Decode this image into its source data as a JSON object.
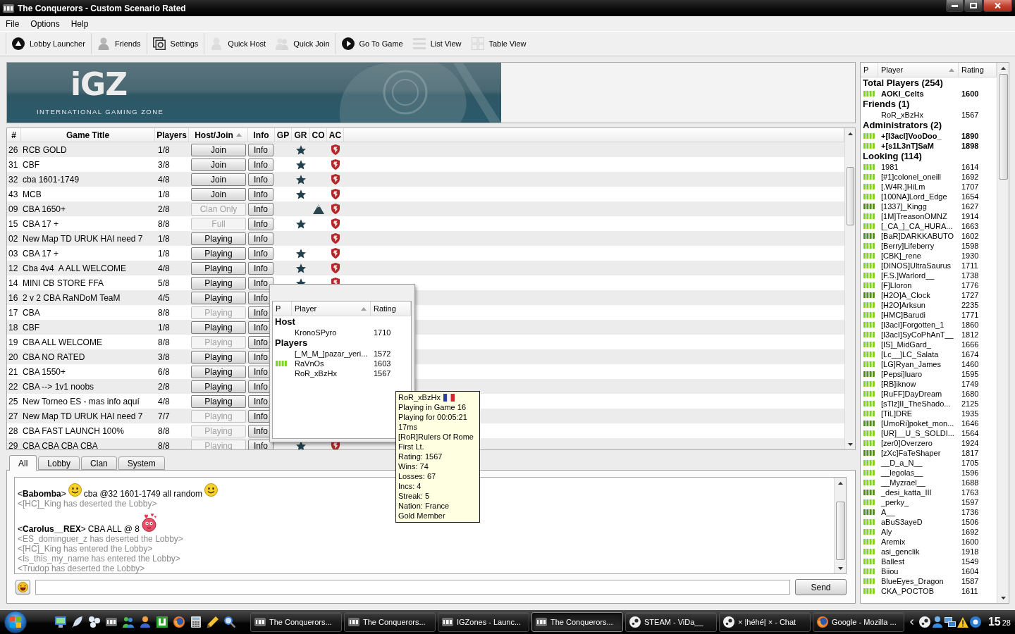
{
  "window": {
    "title": "The Conquerors - Custom Scenario Rated"
  },
  "menu": [
    {
      "label": "File"
    },
    {
      "label": "Options"
    },
    {
      "label": "Help"
    }
  ],
  "toolbar": [
    [
      {
        "label": "Lobby Launcher",
        "kind": "launcher",
        "disabled": false
      }
    ],
    [
      {
        "label": "Friends",
        "kind": "friends",
        "disabled": false
      }
    ],
    [
      {
        "label": "Settings",
        "kind": "settings",
        "disabled": false
      }
    ],
    [
      {
        "label": "Quick Host",
        "kind": "host",
        "disabled": true
      },
      {
        "label": "Quick Join",
        "kind": "join",
        "disabled": true
      }
    ],
    [
      {
        "label": "Go To Game",
        "kind": "play",
        "disabled": false
      },
      {
        "label": "List View",
        "kind": "list",
        "disabled": true
      },
      {
        "label": "Table View",
        "kind": "table",
        "disabled": true
      }
    ]
  ],
  "banner": {
    "logo": "iGZ",
    "tagline": "INTERNATIONAL GAMING ZONE"
  },
  "games": {
    "columns": [
      {
        "label": "#",
        "sorted": false
      },
      {
        "label": "Game Title",
        "sorted": false
      },
      {
        "label": "Players",
        "sorted": false
      },
      {
        "label": "Host/Join",
        "sorted": true
      },
      {
        "label": "Info",
        "sorted": false
      },
      {
        "label": "GP",
        "sorted": false
      },
      {
        "label": "GR",
        "sorted": false
      },
      {
        "label": "CO",
        "sorted": false
      },
      {
        "label": "AC",
        "sorted": false
      }
    ],
    "rows": [
      {
        "number": "26",
        "title": "RCB GOLD",
        "players": "1/8",
        "action": "Join",
        "disabled": false,
        "info": "Info",
        "gr": true,
        "co": false,
        "ac": true
      },
      {
        "number": "31",
        "title": "CBF",
        "players": "3/8",
        "action": "Join",
        "disabled": false,
        "info": "Info",
        "gr": true,
        "co": false,
        "ac": true
      },
      {
        "number": "32",
        "title": "cba 1601-1749",
        "players": "4/8",
        "action": "Join",
        "disabled": false,
        "info": "Info",
        "gr": true,
        "co": false,
        "ac": true
      },
      {
        "number": "43",
        "title": "MCB",
        "players": "1/8",
        "action": "Join",
        "disabled": false,
        "info": "Info",
        "gr": true,
        "co": false,
        "ac": true
      },
      {
        "number": "09",
        "title": "CBA 1650+",
        "players": "2/8",
        "action": "Clan Only",
        "disabled": true,
        "info": "Info",
        "gr": false,
        "co": true,
        "ac": true
      },
      {
        "number": "15",
        "title": "CBA 17 +",
        "players": "8/8",
        "action": "Full",
        "disabled": true,
        "info": "Info",
        "gr": true,
        "co": false,
        "ac": true
      },
      {
        "number": "02",
        "title": "New Map TD URUK HAI need 7",
        "players": "1/8",
        "action": "Playing",
        "disabled": false,
        "info": "Info",
        "gr": false,
        "co": false,
        "ac": true
      },
      {
        "number": "03",
        "title": "CBA 17 +",
        "players": "1/8",
        "action": "Playing",
        "disabled": false,
        "info": "Info",
        "gr": true,
        "co": false,
        "ac": true
      },
      {
        "number": "12",
        "title": "Cba 4v4  A ALL WELCOME",
        "players": "4/8",
        "action": "Playing",
        "disabled": false,
        "info": "Info",
        "gr": true,
        "co": false,
        "ac": true
      },
      {
        "number": "14",
        "title": "MINI CB STORE FFA",
        "players": "5/8",
        "action": "Playing",
        "disabled": false,
        "info": "Info",
        "gr": true,
        "co": false,
        "ac": true
      },
      {
        "number": "16",
        "title": "2 v 2 CBA RaNDoM TeaM",
        "players": "4/5",
        "action": "Playing",
        "disabled": false,
        "info": "Info"
      },
      {
        "number": "17",
        "title": "CBA",
        "players": "8/8",
        "action": "Playing",
        "disabled": true,
        "info": "Info"
      },
      {
        "number": "18",
        "title": "CBF",
        "players": "1/8",
        "action": "Playing",
        "disabled": false,
        "info": "Info"
      },
      {
        "number": "19",
        "title": "CBA ALL WELCOME",
        "players": "8/8",
        "action": "Playing",
        "disabled": true,
        "info": "Info"
      },
      {
        "number": "20",
        "title": "CBA NO RATED",
        "players": "3/8",
        "action": "Playing",
        "disabled": false,
        "info": "Info"
      },
      {
        "number": "21",
        "title": "CBA 1550+",
        "players": "6/8",
        "action": "Playing",
        "disabled": false,
        "info": "Info"
      },
      {
        "number": "22",
        "title": "CBA --> 1v1 noobs",
        "players": "2/8",
        "action": "Playing",
        "disabled": false,
        "info": "Info"
      },
      {
        "number": "25",
        "title": "New Torneo ES - mas info aquí",
        "players": "4/8",
        "action": "Playing",
        "disabled": false,
        "info": "Info"
      },
      {
        "number": "27",
        "title": "New Map TD URUK HAI need 7",
        "players": "7/7",
        "action": "Playing",
        "disabled": true,
        "info": "Info"
      },
      {
        "number": "28",
        "title": "CBA FAST LAUNCH 100%",
        "players": "8/8",
        "action": "Playing",
        "disabled": true,
        "info": "Info"
      },
      {
        "number": "29",
        "title": "CBA CBA CBA CBA",
        "players": "8/8",
        "action": "Playing",
        "disabled": true,
        "info": "Info",
        "gr": true,
        "co": false,
        "ac": true
      }
    ]
  },
  "players_panel": {
    "columns": [
      {
        "label": "P",
        "sorted": false
      },
      {
        "label": "Player",
        "sorted": true
      },
      {
        "label": "Rating",
        "sorted": false
      }
    ],
    "groups": [
      {
        "title": "Total Players (254)",
        "players": [
          {
            "name": "AOKI_Celts",
            "rating": "1600",
            "emphasized": true,
            "color": "#7cd420"
          }
        ]
      },
      {
        "title": "Friends (1)",
        "players": [
          {
            "name": "RoR_xBzHx",
            "rating": "1567",
            "emphasized": false
          }
        ]
      },
      {
        "title": "Administrators (2)",
        "players": [
          {
            "name": "+[I3acI]VooDoo_",
            "rating": "1890",
            "emphasized": true,
            "color": "#7cd420"
          },
          {
            "name": "+[s1L3nT]SaM",
            "rating": "1898",
            "emphasized": true,
            "color": "#7cd420"
          }
        ]
      },
      {
        "title": "Looking (114)",
        "players": [
          {
            "name": "1981",
            "rating": "1614",
            "emphasized": false,
            "color": "#7cd420"
          },
          {
            "name": "[#1]colonel_oneill",
            "rating": "1692",
            "emphasized": false,
            "color": "#7cd420"
          },
          {
            "name": "[.W4R.]HiLm",
            "rating": "1707",
            "emphasized": false,
            "color": "#7cd420"
          },
          {
            "name": "[100NA]Lord_Edge",
            "rating": "1654",
            "emphasized": false,
            "color": "#7cd420"
          },
          {
            "name": "[1337]_Kingg",
            "rating": "1627",
            "emphasized": false,
            "color": "#4f8f1c"
          },
          {
            "name": "[1M]TreasonOMNZ",
            "rating": "1914",
            "emphasized": false,
            "color": "#7cd420"
          },
          {
            "name": "[_CA_]_CA_HURA...",
            "rating": "1663",
            "emphasized": false,
            "color": "#7cd420"
          },
          {
            "name": "[BaR]DARKKABUTO",
            "rating": "1602",
            "emphasized": false,
            "color": "#4f8f1c"
          },
          {
            "name": "[Berry]Lifeberry",
            "rating": "1598",
            "emphasized": false,
            "color": "#7cd420"
          },
          {
            "name": "[CBK]_rene",
            "rating": "1930",
            "emphasized": false,
            "color": "#7cd420"
          },
          {
            "name": "[DINOS]UltraSaurus",
            "rating": "1711",
            "emphasized": false,
            "color": "#7cd420"
          },
          {
            "name": "[F.S.]Warlord__",
            "rating": "1738",
            "emphasized": false,
            "color": "#7cd420"
          },
          {
            "name": "[F]Lloron",
            "rating": "1776",
            "emphasized": false,
            "color": "#7cd420"
          },
          {
            "name": "[H2O]A_Clock",
            "rating": "1727",
            "emphasized": false,
            "color": "#4f8f1c"
          },
          {
            "name": "[H2O]Arksun",
            "rating": "2235",
            "emphasized": false,
            "color": "#7cd420"
          },
          {
            "name": "[HMC]Barudi",
            "rating": "1771",
            "emphasized": false,
            "color": "#7cd420"
          },
          {
            "name": "[I3acI]Forgotten_1",
            "rating": "1860",
            "emphasized": false,
            "color": "#7cd420"
          },
          {
            "name": "[I3acI]SyCoPhAnT__",
            "rating": "1812",
            "emphasized": false,
            "color": "#7cd420"
          },
          {
            "name": "[IS]_MidGard_",
            "rating": "1666",
            "emphasized": false,
            "color": "#7cd420"
          },
          {
            "name": "[Lc__]LC_Salata",
            "rating": "1674",
            "emphasized": false,
            "color": "#7cd420"
          },
          {
            "name": "[LG]Ryan_James",
            "rating": "1460",
            "emphasized": false,
            "color": "#7cd420"
          },
          {
            "name": "[Pepsi]luaro",
            "rating": "1595",
            "emphasized": false,
            "color": "#4f8f1c"
          },
          {
            "name": "[RB]iknow",
            "rating": "1749",
            "emphasized": false,
            "color": "#7cd420"
          },
          {
            "name": "[RuFF]DayDream",
            "rating": "1680",
            "emphasized": false,
            "color": "#7cd420"
          },
          {
            "name": "[sTlz]II_TheShado...",
            "rating": "2125",
            "emphasized": false,
            "color": "#7cd420"
          },
          {
            "name": "[TiL]DRE",
            "rating": "1935",
            "emphasized": false,
            "color": "#7cd420"
          },
          {
            "name": "[UmoRi]poket_mon...",
            "rating": "1646",
            "emphasized": false,
            "color": "#4f8f1c"
          },
          {
            "name": "[UR]__U_S_SOLDI...",
            "rating": "1564",
            "emphasized": false,
            "color": "#7cd420"
          },
          {
            "name": "[zer0]Overzero",
            "rating": "1924",
            "emphasized": false,
            "color": "#7cd420"
          },
          {
            "name": "[zXc]FaTeShaper",
            "rating": "1817",
            "emphasized": false,
            "color": "#4f8f1c"
          },
          {
            "name": "__D_a_N__",
            "rating": "1705",
            "emphasized": false,
            "color": "#7cd420"
          },
          {
            "name": "__legolas__",
            "rating": "1596",
            "emphasized": false,
            "color": "#7cd420"
          },
          {
            "name": "__Myzrael__",
            "rating": "1688",
            "emphasized": false,
            "color": "#7cd420"
          },
          {
            "name": "_desi_katta_III",
            "rating": "1763",
            "emphasized": false,
            "color": "#4f8f1c"
          },
          {
            "name": "_perky_",
            "rating": "1597",
            "emphasized": false,
            "color": "#7cd420"
          },
          {
            "name": "A__",
            "rating": "1736",
            "emphasized": false,
            "color": "#4f8f1c"
          },
          {
            "name": "aBuS3ayeD",
            "rating": "1506",
            "emphasized": false,
            "color": "#7cd420"
          },
          {
            "name": "Aly",
            "rating": "1692",
            "emphasized": false,
            "color": "#7cd420"
          },
          {
            "name": "Aremix",
            "rating": "1600",
            "emphasized": false,
            "color": "#7cd420"
          },
          {
            "name": "asi_genclik",
            "rating": "1918",
            "emphasized": false,
            "color": "#7cd420"
          },
          {
            "name": "Ballest",
            "rating": "1549",
            "emphasized": false,
            "color": "#7cd420"
          },
          {
            "name": "Biiou",
            "rating": "1604",
            "emphasized": false,
            "color": "#7cd420"
          },
          {
            "name": "BlueEyes_Dragon",
            "rating": "1587",
            "emphasized": false,
            "color": "#7cd420"
          },
          {
            "name": "CKA_POCTOB",
            "rating": "1611",
            "emphasized": false,
            "color": "#7cd420"
          }
        ]
      }
    ]
  },
  "chat": {
    "tabs": [
      {
        "label": "All",
        "selected": true
      },
      {
        "label": "Lobby",
        "selected": false
      },
      {
        "label": "Clan",
        "selected": false
      },
      {
        "label": "System",
        "selected": false
      }
    ],
    "messages": [
      {
        "kind": "user",
        "sender": "<**Babomba**>",
        "segments": [
          {
            "kind": "smiley"
          },
          {
            "kind": "text",
            "text": "cba @32 1601-1749 all random"
          },
          {
            "kind": "smiley"
          }
        ]
      },
      {
        "kind": "system",
        "text": "<[HC]_King has deserted the Lobby>"
      },
      {
        "kind": "user",
        "sender": "<**Carolus__REX**>",
        "segments": [
          {
            "kind": "text",
            "text": "CBA ALL @ 8"
          },
          {
            "kind": "love"
          }
        ]
      },
      {
        "kind": "system",
        "text": "<ES_dominguer_z has deserted the Lobby>"
      },
      {
        "kind": "system",
        "text": "<[HC]_King has entered the Lobby>"
      },
      {
        "kind": "system",
        "text": "<Is_this_my_name has entered the Lobby>"
      },
      {
        "kind": "system",
        "text": "<Trudop has deserted the Lobby>"
      }
    ],
    "send": "Send"
  },
  "game_popup": {
    "columns": [
      {
        "label": "P",
        "sorted": false
      },
      {
        "label": "Player",
        "sorted": true
      },
      {
        "label": "Rating",
        "sorted": false
      }
    ],
    "groups": [
      {
        "title": "Host",
        "players": [
          {
            "name": "KronoSPyro",
            "rating": "1710"
          }
        ]
      },
      {
        "title": "Players",
        "players": [
          {
            "name": "[_M_M_]pazar_yeri...",
            "rating": "1572"
          },
          {
            "name": "RaVnOs",
            "rating": "1603",
            "color": "#7cd420"
          },
          {
            "name": "RoR_xBzHx",
            "rating": "1567"
          }
        ]
      }
    ]
  },
  "tooltip": {
    "name": "RoR_xBzHx",
    "lines": [
      "Playing in Game 16",
      "Playing for 00:05:21",
      "17ms",
      "[RoR]Rulers Of Rome",
      "First Lt.",
      "Rating: 1567",
      "Wins: 74",
      "Losses: 67",
      "Incs: 4",
      "Streak: 5",
      "Nation: France",
      "Gold Member"
    ]
  },
  "taskbar": {
    "tasks": [
      {
        "label": "The Conquerors...",
        "kind": "igz",
        "selected": false
      },
      {
        "label": "The Conquerors...",
        "kind": "igz",
        "selected": false
      },
      {
        "label": "IGZones - Launc...",
        "kind": "igz",
        "selected": false
      },
      {
        "label": "The Conquerors...",
        "kind": "igz",
        "selected": true
      },
      {
        "label": "STEAM - ViDa__",
        "kind": "steam",
        "selected": false
      },
      {
        "label": "× |héhé| × - Chat",
        "kind": "steam",
        "selected": false
      },
      {
        "label": "Google - Mozilla ...",
        "kind": "firefox",
        "selected": false
      }
    ],
    "clock": {
      "hours": "15",
      "minutes": "28"
    }
  }
}
